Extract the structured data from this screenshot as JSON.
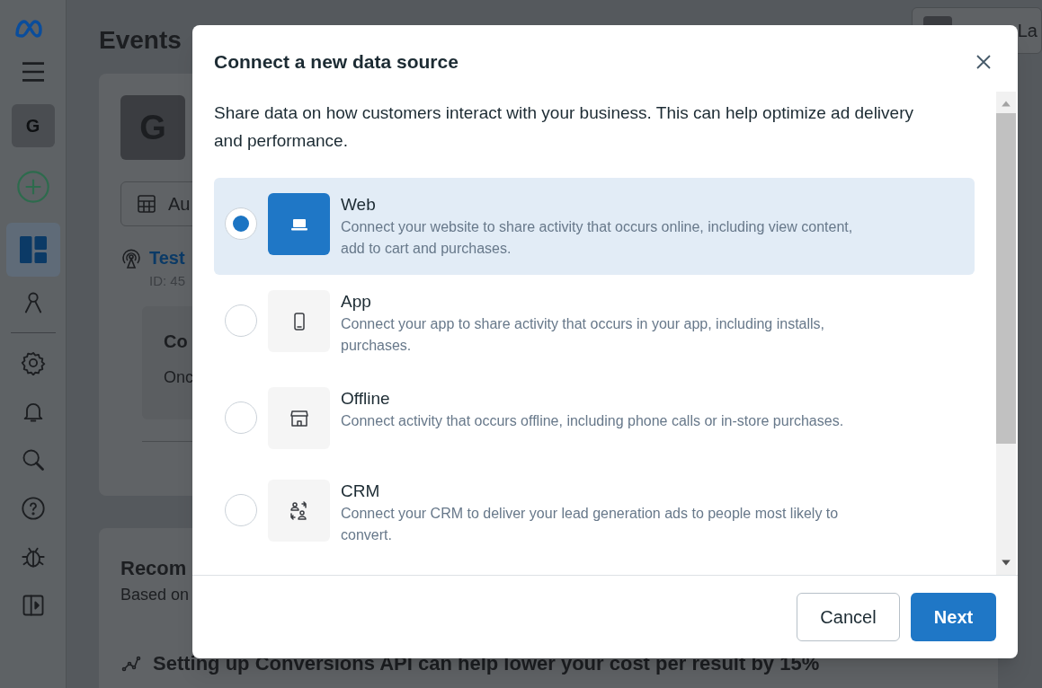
{
  "background": {
    "sidebar": {
      "avatar": "G",
      "items": [
        {
          "kind": "menu"
        },
        {
          "kind": "avatar"
        },
        {
          "kind": "add"
        },
        {
          "kind": "overview",
          "selected": true
        },
        {
          "kind": "people",
          "selected": false
        },
        {
          "kind": "settings",
          "selected": false
        },
        {
          "kind": "bell",
          "selected": false
        },
        {
          "kind": "search",
          "selected": false
        },
        {
          "kind": "help",
          "selected": false
        },
        {
          "kind": "bug",
          "selected": false
        },
        {
          "kind": "panel",
          "selected": false
        }
      ]
    },
    "page_title": "Events",
    "top_button": "La",
    "business_avatar": "G",
    "dropdown": "Au",
    "dataset_name": "Test",
    "dataset_id": "ID: 45",
    "notice_title": "Co",
    "notice_text": "Onc",
    "recommend_title": "Recom",
    "recommend_subtitle": "Based on",
    "recommend_headline": "Setting up Conversions API can help lower your cost per result by 15%"
  },
  "dialog": {
    "title": "Connect a new data source",
    "intro": "Share data on how customers interact with your business. This can help optimize ad delivery and performance.",
    "options": [
      {
        "kind": "web",
        "title": "Web",
        "description": "Connect your website to share activity that occurs online, including view content, add to cart and purchases.",
        "selected": true
      },
      {
        "kind": "app",
        "title": "App",
        "description": "Connect your app to share activity that occurs in your app, including installs, purchases.",
        "selected": false
      },
      {
        "kind": "offline",
        "title": "Offline",
        "description": "Connect activity that occurs offline, including phone calls or in-store purchases.",
        "selected": false
      },
      {
        "kind": "crm",
        "title": "CRM",
        "description": "Connect your CRM to deliver your lead generation ads to people most likely to convert.",
        "selected": false
      }
    ],
    "buttons": [
      {
        "kind": "secondary",
        "label": "Cancel"
      },
      {
        "kind": "primary",
        "label": "Next"
      }
    ]
  }
}
